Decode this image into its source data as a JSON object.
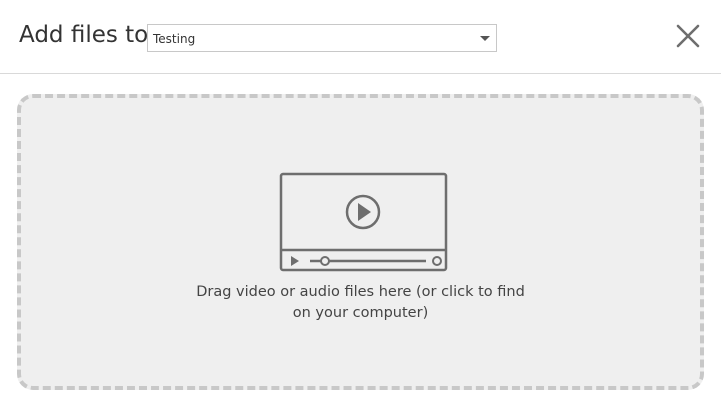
{
  "dialog": {
    "title": "Add files to",
    "destination": {
      "selected": "Testing"
    },
    "close_icon": "close-icon"
  },
  "dropzone": {
    "icon": "video-player-icon",
    "text_line1": "Drag video or audio files here (or click to find",
    "text_line2": "on your computer)"
  },
  "colors": {
    "icon_stroke": "#6e6e6e",
    "dropzone_bg": "#efefef",
    "dropzone_border": "#c8c8c8",
    "header_divider": "#d9d9d9"
  }
}
